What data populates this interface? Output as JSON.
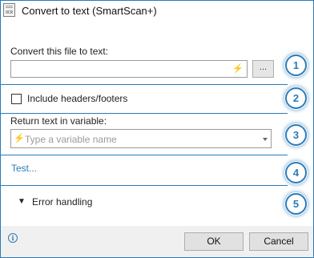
{
  "window": {
    "title": "Convert to text (SmartScan+)"
  },
  "icons": {
    "title": "ocr-document-icon",
    "bolt": "lightning-bolt-icon",
    "info": "info-icon",
    "chevron": "chevron-down-icon"
  },
  "file_section": {
    "label": "Convert this file to text:",
    "value": "",
    "browse_label": "...",
    "badge": "1"
  },
  "headers_section": {
    "checkbox_label": "Include headers/footers",
    "checked": false,
    "badge": "2"
  },
  "variable_section": {
    "label": "Return text in variable:",
    "placeholder": "Type a variable name",
    "badge": "3"
  },
  "test_section": {
    "link_label": "Test...",
    "badge": "4"
  },
  "error_section": {
    "label": "Error handling",
    "badge": "5"
  },
  "footer": {
    "ok_label": "OK",
    "cancel_label": "Cancel"
  },
  "colors": {
    "accent": "#2b7bb9",
    "footer_bg": "#f0f0f0"
  }
}
